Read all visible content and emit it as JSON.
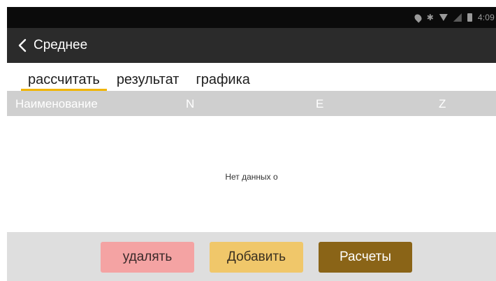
{
  "status_bar": {
    "icons": [
      "location-icon",
      "bluetooth-icon",
      "wifi-icon",
      "signal-icon",
      "battery-icon"
    ],
    "time": "4:09"
  },
  "app_bar": {
    "back_icon": "chevron-left-icon",
    "title": "Среднее"
  },
  "tabs": [
    {
      "label": "рассчитать",
      "active": true
    },
    {
      "label": "результат",
      "active": false
    },
    {
      "label": "графика",
      "active": false
    }
  ],
  "table": {
    "columns": [
      "Наименование",
      "N",
      "E",
      "Z"
    ],
    "empty_message": "Нет данных о"
  },
  "buttons": {
    "delete": "удалять",
    "add": "Добавить",
    "calculate": "Расчеты"
  },
  "colors": {
    "status_bar_bg": "#0b0b0b",
    "app_bar_bg": "#2b2b2b",
    "tab_indicator": "#f0b400",
    "header_bg": "#cfcfcf",
    "delete_bg": "#f4a3a3",
    "add_bg": "#f0c76a",
    "calc_bg": "#8a6417"
  }
}
